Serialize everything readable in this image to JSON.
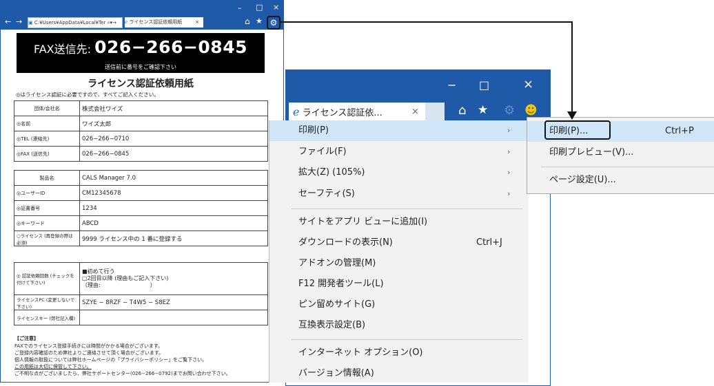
{
  "small_window": {
    "address": "C:¥Users¥AppData¥Local¥Ter",
    "tab_title": "ライセンス認証依頼用紙",
    "tab_close": "×",
    "icons": [
      "back-icon",
      "forward-icon",
      "home-icon",
      "favorites-icon",
      "gear-icon"
    ],
    "win_min": "–",
    "win_max": "□",
    "win_close": "×"
  },
  "form": {
    "fax_prefix": "FAX送信先:",
    "fax_number": "026−266−0845",
    "fax_note": "送信前に番号をご確認下さい",
    "title": "ライセンス認証依頼用紙",
    "note": "◎はライセンス認証に必要ですので、すべてご記入ください。",
    "table1": [
      {
        "label": "団体/会社名",
        "value": "株式会社ワイズ"
      },
      {
        "label": "◎名前",
        "value": "ワイズ太郎"
      },
      {
        "label": "◎TEL (連絡先)",
        "value": "026−266−0710"
      },
      {
        "label": "◎FAX (送信先)",
        "value": "026−266−0845"
      }
    ],
    "table2": [
      {
        "label": "製品名",
        "value": "CALS Manager 7.0"
      },
      {
        "label": "◎ユーザーID",
        "value": "CM12345678"
      },
      {
        "label": "◎証書番号",
        "value": "1234"
      },
      {
        "label": "◎キーワード",
        "value": "ABCD"
      },
      {
        "label": "○ライセンス (再登録の際は必須)",
        "value": "9999 ライセンス中の 1 番に登録する"
      }
    ],
    "table3": [
      {
        "label": "◎ 認証依頼回数 (チェックを付けて下さい)",
        "line1": "■初めて行う",
        "line2": "□2回目以降 (理由もご記入下さい)",
        "line3": "（理由:　　　　　　　　　）"
      },
      {
        "label": "ライセンスPC (変更しないで下さい)",
        "value": "SZYE − 8RZF − T4W5 − S8EZ"
      },
      {
        "label": "ライセンスキー (弊社記入欄)",
        "value": ""
      }
    ],
    "notes_header": "【ご注意】",
    "notes": [
      "FAXでのライセンス登録手続きには時間がかかる場合がございます。",
      "ご登録内容確認のため弊社よりご連絡させて頂く場合がございます。",
      "個人情報の取扱については弊社ホームページの「プライバシーポリシー」をご覧下さい。",
      "この用紙は大切に保管して下さい。",
      "ご不明な点がございましたら、弊社サポートセンター(026−266−0792)までお問い合わせ下さい。"
    ]
  },
  "big_window": {
    "tab_title": "ライセンス認証依...",
    "tab_close": "×",
    "win_min": "−",
    "win_max": "□",
    "win_close": "×",
    "icons": [
      "ie-logo-icon",
      "home-icon",
      "favorites-star-icon",
      "gear-icon",
      "smiley-feedback-icon"
    ]
  },
  "menu": {
    "items": [
      {
        "label": "印刷(P)",
        "arrow": "›",
        "highlighted": true
      },
      {
        "label": "ファイル(F)",
        "arrow": "›"
      },
      {
        "label": "拡大(Z) (105%)",
        "arrow": "›"
      },
      {
        "label": "セーフティ(S)",
        "arrow": "›"
      },
      {
        "label": "サイトをアプリ ビューに追加(I)"
      },
      {
        "label": "ダウンロードの表示(N)",
        "shortcut": "Ctrl+J"
      },
      {
        "label": "アドオンの管理(M)"
      },
      {
        "label": "F12 開発者ツール(L)"
      },
      {
        "label": "ピン留めサイト(G)"
      },
      {
        "label": "互換表示設定(B)"
      },
      {
        "label": "インターネット オプション(O)"
      },
      {
        "label": "バージョン情報(A)"
      }
    ]
  },
  "submenu": {
    "items": [
      {
        "label": "印刷(P)...",
        "shortcut": "Ctrl+P",
        "highlighted": true
      },
      {
        "label": "印刷プレビュー(V)..."
      },
      {
        "label": "ページ設定(U)..."
      }
    ]
  },
  "colors": {
    "titlebar": "#1e5aa8",
    "menu_bg": "#f2f2f2",
    "menu_highlight": "#cfe6f8"
  }
}
